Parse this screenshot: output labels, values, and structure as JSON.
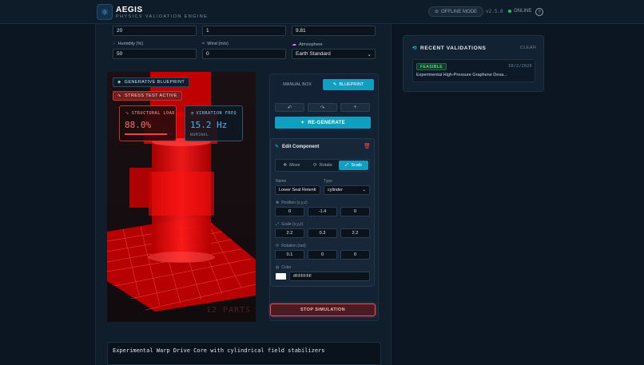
{
  "header": {
    "title": "AEGIS",
    "subtitle": "PHYSICS VALIDATION ENGINE",
    "offline_mode": "OFFLINE MODE",
    "version": "v2.5.0",
    "status": "ONLINE",
    "help": "?"
  },
  "environment": {
    "fields_top": [
      "20",
      "1",
      "9.81"
    ],
    "humidity_label": "Humidity (%)",
    "humidity": "50",
    "wind_label": "Wind (m/s)",
    "wind": "0",
    "atmosphere_label": "Atmosphere",
    "atmosphere": "Earth Standard"
  },
  "viewport": {
    "blueprint_tag": "GENERATIVE BLUEPRINT",
    "stress_tag": "STRESS TEST ACTIVE",
    "structural_load_label": "STRUCTURAL LOAD",
    "structural_load": "88.0%",
    "structural_load_fraction": 0.88,
    "vibration_label": "VIBRATION FREQ",
    "vibration": "15.2 Hz",
    "vibration_status": "NOMINAL",
    "parts": "12 PARTS"
  },
  "controls": {
    "tab_manual": "MANUAL BOX",
    "tab_blueprint": "BLUEPRINT",
    "undo": "↶",
    "redo": "↷",
    "add": "+",
    "regenerate": "RE-GENERATE"
  },
  "editor": {
    "title": "Edit Component",
    "modes": [
      "Move",
      "Rotate",
      "Scale"
    ],
    "name_label": "Name",
    "name": "Lower Seal Retenti",
    "type_label": "Type",
    "type": "cylinder",
    "position_label": "Position (x,y,z)",
    "position": [
      "0",
      "-1.4",
      "0"
    ],
    "scale_label": "Scale (x,y,z)",
    "scale": [
      "2.2",
      "0.3",
      "2.2"
    ],
    "rotation_label": "Rotation (rad)",
    "rotation": [
      "0.1",
      "0",
      "0"
    ],
    "color_label": "Color",
    "color": "#FFFFFF"
  },
  "stop_simulation": "STOP SIMULATION",
  "prompt": "Experimental Warp Drive Core with cylindrical field stabilizers",
  "recent": {
    "title": "RECENT VALIDATIONS",
    "clear": "CLEAR",
    "items": [
      {
        "status": "FEASIBLE",
        "date": "10/2/2026",
        "name": "Experimental High-Pressure Graphene Desa..."
      }
    ]
  },
  "colors": {
    "accent": "#0e9fc1",
    "danger": "#ef4444",
    "success": "#22c55e",
    "background": "#0b1622"
  }
}
